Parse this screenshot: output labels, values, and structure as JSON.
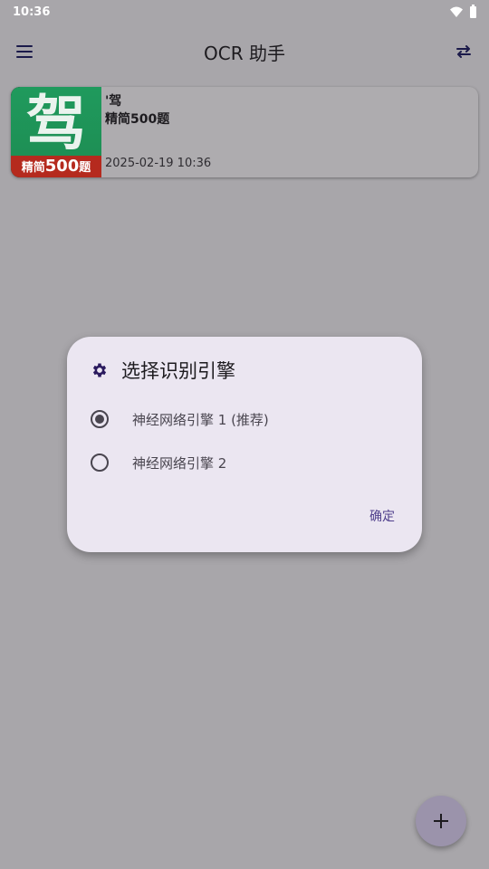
{
  "status_bar": {
    "time": "10:36",
    "icons": [
      "wifi-icon",
      "battery-icon"
    ]
  },
  "app_bar": {
    "title": "OCR 助手",
    "left_icon": "menu-icon",
    "right_icon": "swap-icon"
  },
  "list": {
    "items": [
      {
        "title": "'驾",
        "subtitle": "精简500题",
        "date": "2025-02-19 10:36",
        "thumbnail": {
          "char": "驾",
          "banner_prefix": "精简",
          "banner_number": "500",
          "banner_suffix": "题"
        }
      }
    ]
  },
  "dialog": {
    "icon": "gear-icon",
    "title": "选择识别引擎",
    "options": [
      {
        "label": "神经网络引擎 1 (推荐)",
        "selected": true
      },
      {
        "label": "神经网络引擎 2",
        "selected": false
      }
    ],
    "confirm_label": "确定"
  },
  "fab": {
    "icon": "plus-icon"
  },
  "colors": {
    "scrim_background": "#a8a6aa",
    "dialog_background": "#ebe6f1",
    "accent": "#4f3f8c",
    "fab": "#9b93ab"
  }
}
